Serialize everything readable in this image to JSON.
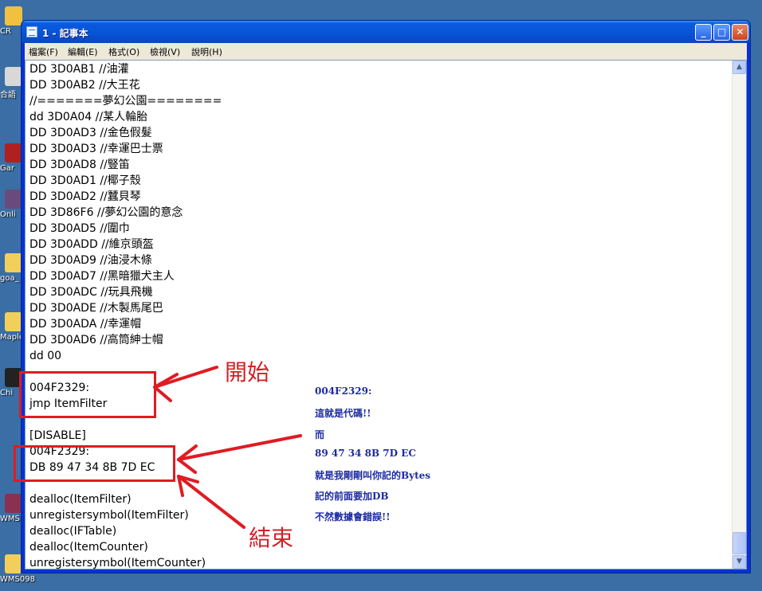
{
  "desktop": {
    "icons": [
      {
        "label": "CR",
        "color": "#f0c040"
      },
      {
        "label": "合語",
        "color": "#d8d8d8"
      },
      {
        "label": "Gar",
        "color": "#b02020"
      },
      {
        "label": "Onli",
        "color": "#6a4a7a"
      },
      {
        "label": "goa_",
        "color": "#f2cf5a"
      },
      {
        "label": "Maple",
        "color": "#f2cf5a"
      },
      {
        "label": "Chi",
        "color": "#222222"
      },
      {
        "label": "WMS",
        "color": "#8a3050"
      },
      {
        "label": "WMS098",
        "color": "#f2cf5a"
      }
    ]
  },
  "window": {
    "title": "1 - 記事本",
    "menu": [
      "檔案(F)",
      "編輯(E)",
      "格式(O)",
      "檢視(V)",
      "說明(H)"
    ],
    "lines": [
      "DD 3D0AB1 //油灌",
      "DD 3D0AB2 //大王花",
      "//=======夢幻公園========",
      "dd 3D0A04 //某人輪胎",
      "DD 3D0AD3 //金色假髮",
      "DD 3D0AD3 //幸運巴士票",
      "DD 3D0AD8 //豎笛",
      "DD 3D0AD1 //椰子殼",
      "DD 3D0AD2 //蠶貝琴",
      "DD 3D86F6 //夢幻公園的意念",
      "DD 3D0AD5 //圍巾",
      "DD 3D0ADD //維京頭盔",
      "DD 3D0AD9 //油浸木條",
      "DD 3D0AD7 //黑暗獵犬主人",
      "DD 3D0ADC //玩具飛機",
      "DD 3D0ADE //木製馬尾巴",
      "DD 3D0ADA //幸運帽",
      "DD 3D0AD6 //高筒紳士帽",
      "dd 00",
      "",
      "004F2329:",
      "jmp ItemFilter",
      "",
      "[DISABLE]",
      "004F2329:",
      "DB 89 47 34 8B 7D EC",
      "",
      "dealloc(ItemFilter)",
      "unregistersymbol(ItemFilter)",
      "dealloc(IFTable)",
      "dealloc(ItemCounter)",
      "unregistersymbol(ItemCounter)"
    ]
  },
  "annotations": {
    "start_label": "開始",
    "end_label": "結束",
    "notes": [
      "004F2329:",
      "這就是代碼!!",
      "而",
      "89 47 34 8B 7D EC",
      "就是我剛剛叫你記的Bytes",
      "記的前面要加DB",
      "不然數據會錯誤!!"
    ]
  }
}
